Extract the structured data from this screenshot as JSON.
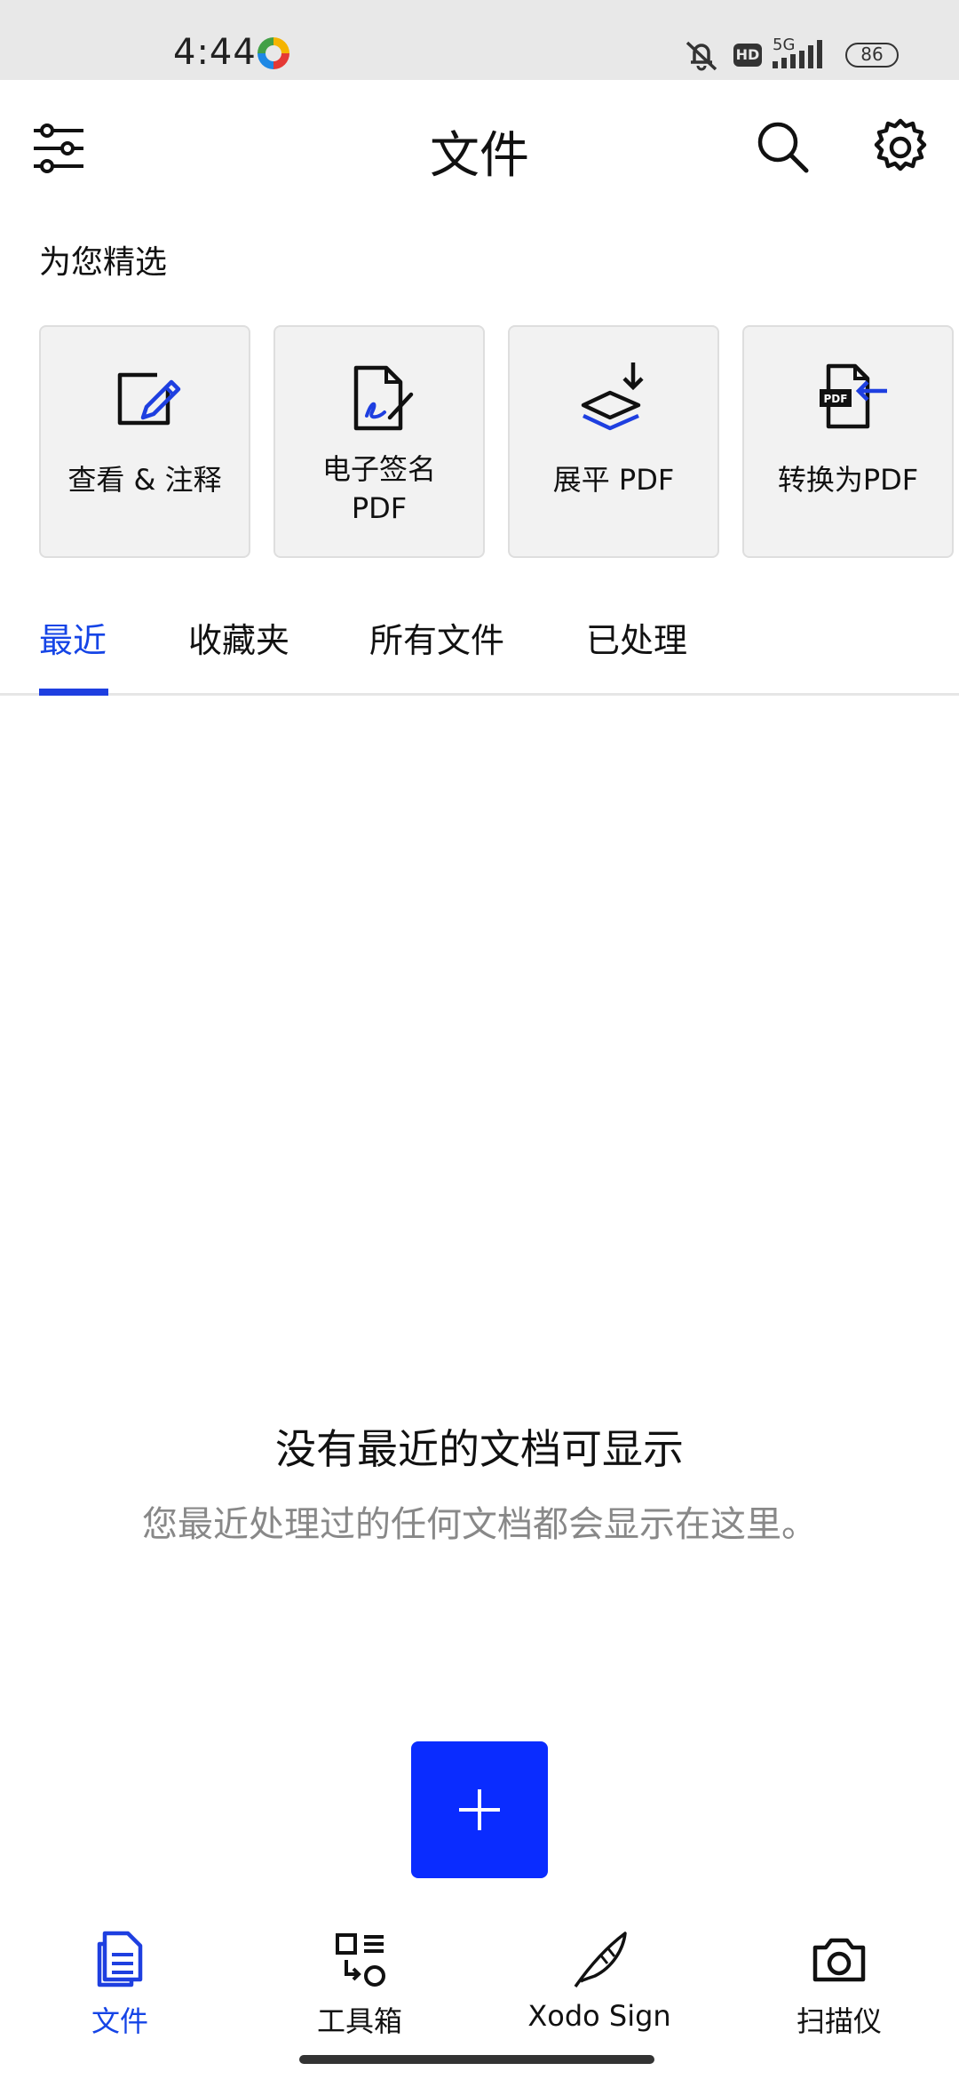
{
  "status_bar": {
    "time": "4:44",
    "network": "5G",
    "hd_badge": "HD",
    "battery": "86"
  },
  "header": {
    "title": "文件",
    "filter_icon": "sliders-icon",
    "search_icon": "search-icon",
    "settings_icon": "gear-icon"
  },
  "featured": {
    "title": "为您精选",
    "cards": [
      {
        "label": "查看 & 注释",
        "icon": "edit-note-icon"
      },
      {
        "label": "电子签名\nPDF",
        "icon": "e-sign-icon"
      },
      {
        "label": "展平 PDF",
        "icon": "flatten-layers-icon"
      },
      {
        "label": "转换为PDF",
        "icon": "convert-pdf-icon"
      }
    ]
  },
  "tabs": [
    {
      "label": "最近",
      "active": true
    },
    {
      "label": "收藏夹",
      "active": false
    },
    {
      "label": "所有文件",
      "active": false
    },
    {
      "label": "已处理",
      "active": false
    }
  ],
  "empty_state": {
    "title": "没有最近的文档可显示",
    "subtitle": "您最近处理过的任何文档都会显示在这里。"
  },
  "fab": {
    "icon": "plus-icon"
  },
  "bottom_nav": [
    {
      "label": "文件",
      "icon": "files-icon",
      "active": true
    },
    {
      "label": "工具箱",
      "icon": "toolbox-icon",
      "active": false
    },
    {
      "label": "Xodo Sign",
      "icon": "quill-pen-icon",
      "active": false
    },
    {
      "label": "扫描仪",
      "icon": "camera-icon",
      "active": false
    }
  ],
  "colors": {
    "accent": "#1544e6",
    "fab": "#0a2cff",
    "status_bar_bg": "#e8e8e8",
    "card_bg": "#f2f2f2"
  }
}
